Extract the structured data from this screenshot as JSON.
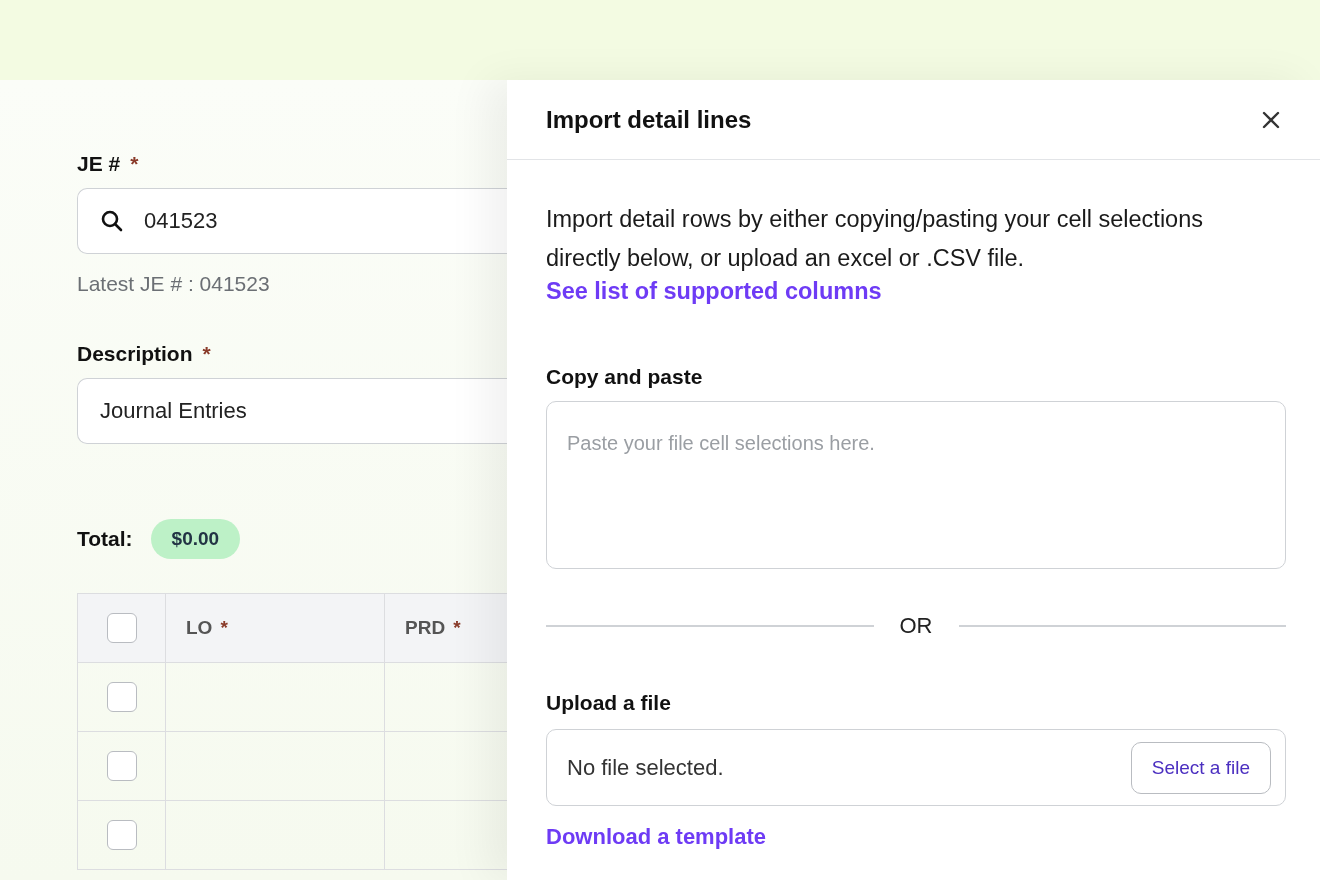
{
  "form": {
    "je_number": {
      "label": "JE #",
      "required_mark": "*",
      "value": "041523",
      "hint": "Latest JE # : 041523"
    },
    "description": {
      "label": "Description",
      "required_mark": "*",
      "value": "Journal Entries"
    },
    "total": {
      "label": "Total:",
      "value": "$0.00"
    },
    "table": {
      "header_checked": false,
      "columns": [
        {
          "label": "LO",
          "required_mark": "*"
        },
        {
          "label": "PRD",
          "required_mark": "*"
        }
      ],
      "rows": [
        {
          "checked": false
        },
        {
          "checked": false
        },
        {
          "checked": false
        }
      ]
    }
  },
  "panel": {
    "title": "Import detail lines",
    "intro": "Import detail rows by either copying/pasting your cell selections directly below, or upload an excel or .CSV file.",
    "columns_link": "See list of supported columns",
    "paste": {
      "label": "Copy and paste",
      "placeholder": "Paste your file cell selections here."
    },
    "separator": "OR",
    "upload": {
      "label": "Upload a file",
      "value": "No file selected.",
      "button": "Select a file"
    },
    "template_link": "Download a template"
  }
}
